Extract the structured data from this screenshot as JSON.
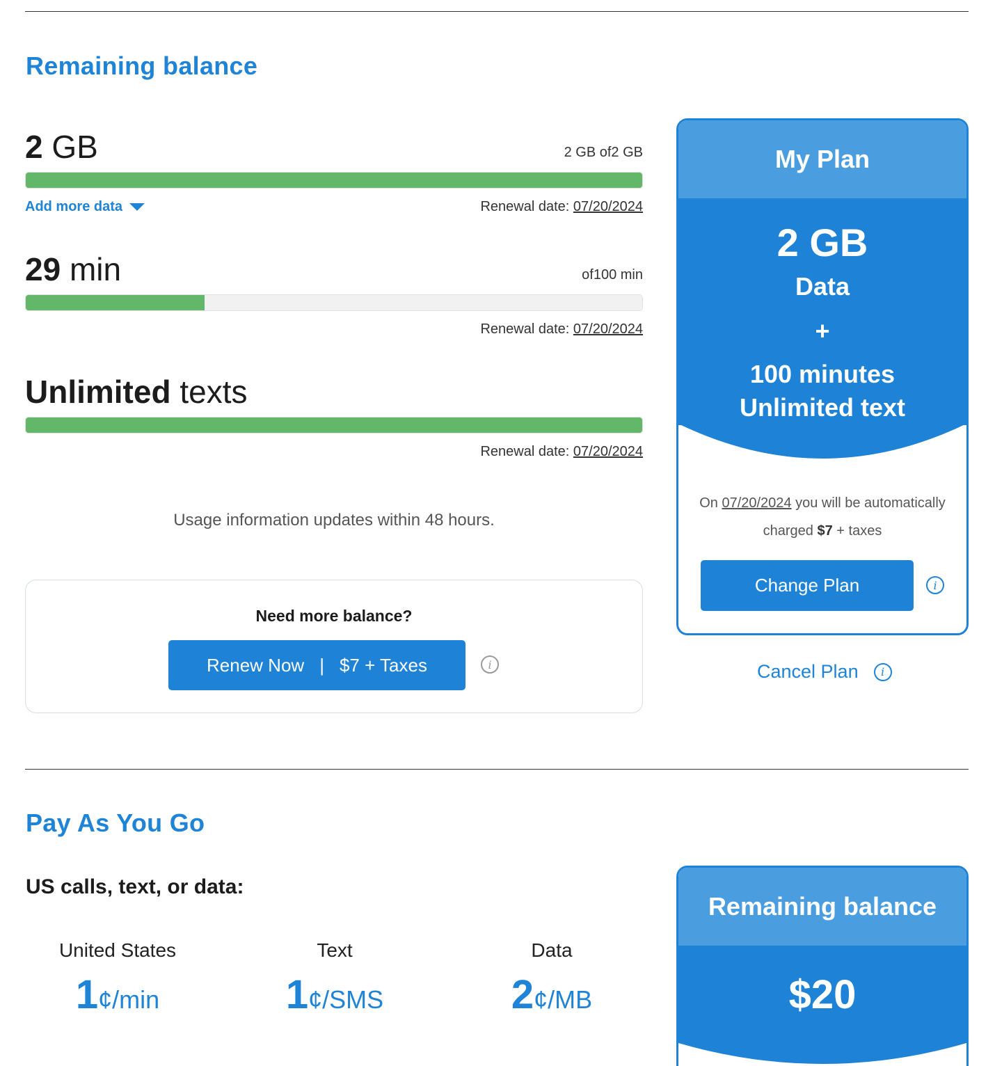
{
  "balance_section": {
    "title": "Remaining balance",
    "data": {
      "amount": "2",
      "unit": "GB",
      "of_text": "2 GB of2 GB",
      "fill_fraction": 1.0,
      "add_more": "Add more data",
      "renewal_label": "Renewal date:",
      "renewal_date": "07/20/2024"
    },
    "minutes": {
      "amount": "29",
      "unit": "min",
      "of_text": "of100 min",
      "fill_fraction": 0.29,
      "renewal_label": "Renewal date:",
      "renewal_date": "07/20/2024"
    },
    "texts": {
      "amount": "Unlimited",
      "unit": "texts",
      "fill_fraction": 1.0,
      "renewal_label": "Renewal date:",
      "renewal_date": "07/20/2024"
    },
    "note": "Usage information updates within 48 hours.",
    "need_more": {
      "question": "Need more balance?",
      "renew_label": "Renew Now",
      "separator": "|",
      "price_label": "$7 + Taxes"
    }
  },
  "plan_card": {
    "title": "My Plan",
    "data_amount": "2 GB",
    "data_label": "Data",
    "plus": "+",
    "minutes": "100 minutes",
    "texts": "Unlimited text",
    "charge_prefix": "On",
    "charge_date": "07/20/2024",
    "charge_mid": "you will be automatically",
    "charge_pre_amount": "charged",
    "charge_amount": "$7",
    "charge_suffix": "+ taxes",
    "change_button": "Change Plan",
    "cancel_link": "Cancel Plan"
  },
  "payg": {
    "title": "Pay As You Go",
    "subtitle": "US calls, text, or data:",
    "rates": [
      {
        "label": "United States",
        "value": "1",
        "unit": "¢/min"
      },
      {
        "label": "Text",
        "value": "1",
        "unit": "¢/SMS"
      },
      {
        "label": "Data",
        "value": "2",
        "unit": "¢/MB"
      }
    ],
    "balance_card": {
      "title": "Remaining balance",
      "amount": "$20"
    }
  },
  "colors": {
    "accent": "#1e82d6",
    "accent_light": "#4a9ee0",
    "bar_fill": "#62b868"
  },
  "icons": {
    "info": "info-icon",
    "dropdown": "caret-down-icon"
  }
}
